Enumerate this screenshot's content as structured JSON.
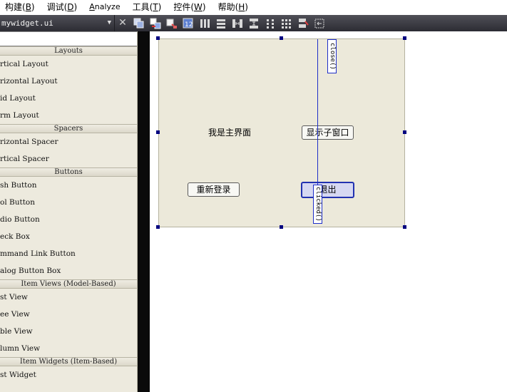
{
  "menu": [
    {
      "label": "构建(",
      "key": "B",
      "tail": ")"
    },
    {
      "label": "调试(",
      "key": "D",
      "tail": ")"
    },
    {
      "label": "",
      "key": "A",
      "tail": "nalyze"
    },
    {
      "label": "工具(",
      "key": "T",
      "tail": ")"
    },
    {
      "label": "控件(",
      "key": "W",
      "tail": ")"
    },
    {
      "label": "帮助(",
      "key": "H",
      "tail": ")"
    }
  ],
  "toolbar": {
    "file_name": "mywidget.ui",
    "combo_arrow": "▼",
    "close_glyph": "✕",
    "icons": [
      "edit-widgets-icon",
      "edit-signals-slots-icon",
      "edit-buddies-icon",
      "edit-tab-order-icon",
      "layout-horizontal-icon",
      "layout-vertical-icon",
      "layout-h-splitter-icon",
      "layout-v-splitter-icon",
      "layout-grid-icon",
      "layout-form-icon",
      "break-layout-icon",
      "adjust-size-icon"
    ]
  },
  "widget_box": {
    "sections": [
      {
        "title": "Layouts",
        "items": [
          "rtical Layout",
          "rizontal Layout",
          "id Layout",
          "rm Layout"
        ]
      },
      {
        "title": "Spacers",
        "items": [
          "rizontal Spacer",
          "rtical Spacer"
        ]
      },
      {
        "title": "Buttons",
        "items": [
          "sh Button",
          "ol Button",
          "dio Button",
          "eck Box",
          "mmand Link Button",
          "alog Button Box"
        ]
      },
      {
        "title": "Item Views (Model-Based)",
        "items": [
          "st View",
          "ee View",
          "ble View",
          "lumn View"
        ]
      },
      {
        "title": "Item Widgets (Item-Based)",
        "items": [
          "st Widget"
        ]
      }
    ]
  },
  "form": {
    "label_text": "我是主界面",
    "show_child_button": "显示子窗口",
    "relogin_button": "重新登录",
    "exit_button": "退出",
    "signal_top": "close()",
    "signal_bottom": "clicked()"
  }
}
